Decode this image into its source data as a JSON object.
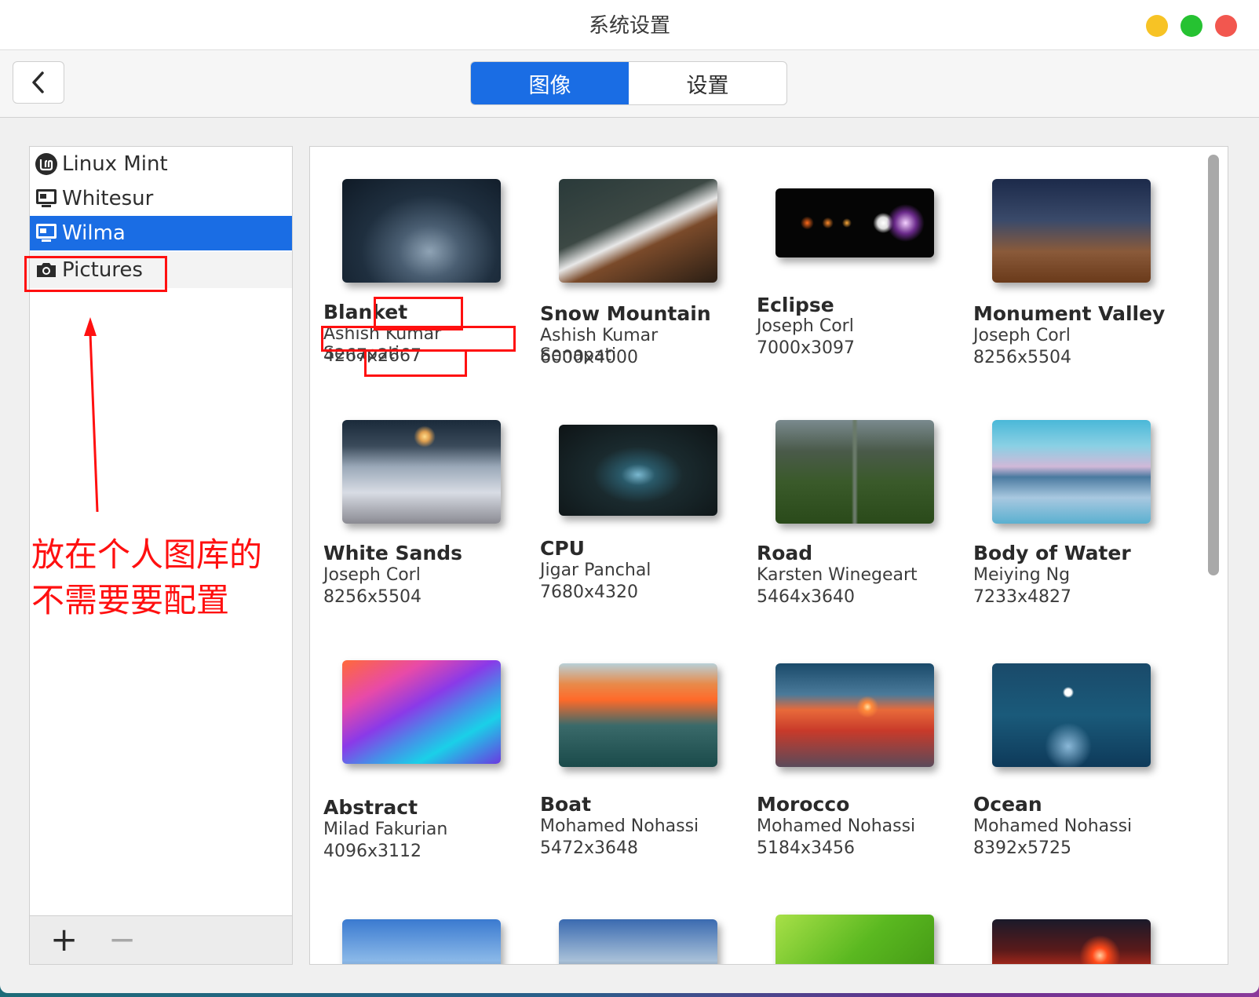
{
  "window": {
    "title": "系统设置"
  },
  "toolbar": {
    "tabs": [
      {
        "label": "图像",
        "active": true
      },
      {
        "label": "设置",
        "active": false
      }
    ]
  },
  "sidebar": {
    "items": [
      {
        "label": "Linux Mint",
        "icon": "linux-mint-logo-icon"
      },
      {
        "label": "Whitesur",
        "icon": "monitor-icon"
      },
      {
        "label": "Wilma",
        "icon": "monitor-icon",
        "selected": true
      },
      {
        "label": "Pictures",
        "icon": "camera-icon"
      }
    ],
    "add_label": "+",
    "remove_label": "−"
  },
  "annotation": {
    "line1": "放在个人图库的",
    "line2": "不需要要配置"
  },
  "wallpapers": [
    {
      "title": "Blanket",
      "author": "Ashish Kumar Senapati",
      "size": "4267x2667"
    },
    {
      "title": "Snow Mountain",
      "author": "Ashish Kumar Senapati",
      "size": "6000x4000"
    },
    {
      "title": "Eclipse",
      "author": "Joseph Corl",
      "size": "7000x3097"
    },
    {
      "title": "Monument Valley",
      "author": "Joseph Corl",
      "size": "8256x5504"
    },
    {
      "title": "White Sands",
      "author": "Joseph Corl",
      "size": "8256x5504"
    },
    {
      "title": "CPU",
      "author": "Jigar Panchal",
      "size": "7680x4320"
    },
    {
      "title": "Road",
      "author": "Karsten Winegeart",
      "size": "5464x3640"
    },
    {
      "title": "Body of Water",
      "author": "Meiying Ng",
      "size": "7233x4827"
    },
    {
      "title": "Abstract",
      "author": "Milad Fakurian",
      "size": "4096x3112"
    },
    {
      "title": "Boat",
      "author": "Mohamed Nohassi",
      "size": "5472x3648"
    },
    {
      "title": "Morocco",
      "author": "Mohamed Nohassi",
      "size": "5184x3456"
    },
    {
      "title": "Ocean",
      "author": "Mohamed Nohassi",
      "size": "8392x5725"
    }
  ],
  "colors": {
    "accent": "#1a6de4",
    "annotation": "#ff1010"
  }
}
